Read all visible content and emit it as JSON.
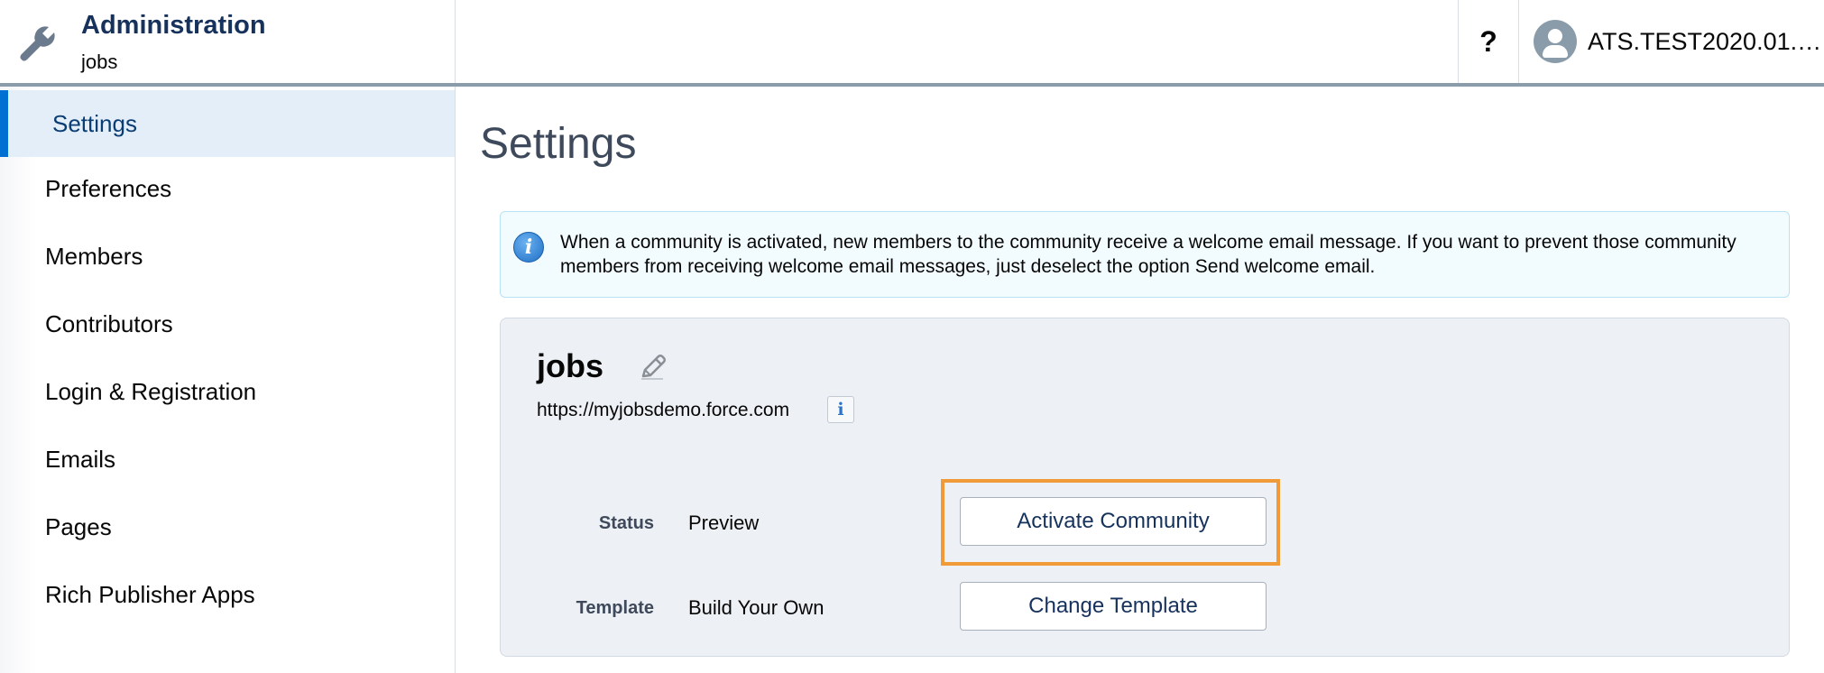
{
  "header": {
    "app_title": "Administration",
    "app_subtitle": "jobs",
    "help_label": "?",
    "user_name": "ATS.TEST2020.01.2..."
  },
  "sidebar": {
    "items": [
      {
        "label": "Settings",
        "active": true
      },
      {
        "label": "Preferences"
      },
      {
        "label": "Members"
      },
      {
        "label": "Contributors"
      },
      {
        "label": "Login & Registration"
      },
      {
        "label": "Emails"
      },
      {
        "label": "Pages"
      },
      {
        "label": "Rich Publisher Apps"
      }
    ]
  },
  "main": {
    "title": "Settings",
    "info_message": "When a community is activated, new members to the community receive a welcome email message. If you want to prevent those community members from receiving welcome email messages, just deselect the option Send welcome email.",
    "community": {
      "name": "jobs",
      "url": "https://myjobsdemo.force.com",
      "status_label": "Status",
      "status_value": "Preview",
      "template_label": "Template",
      "template_value": "Build Your Own",
      "activate_button": "Activate Community",
      "change_template_button": "Change Template"
    }
  },
  "colors": {
    "active_nav_bar": "#0070d2",
    "active_nav_bg": "#e4eef8",
    "highlight_border": "#f19a38",
    "info_bg": "#f2fbfe",
    "panel_bg": "#edf0f4"
  },
  "icons": {
    "app": "wrench-icon",
    "info": "info-icon",
    "edit": "pencil-icon",
    "user": "avatar-icon"
  }
}
